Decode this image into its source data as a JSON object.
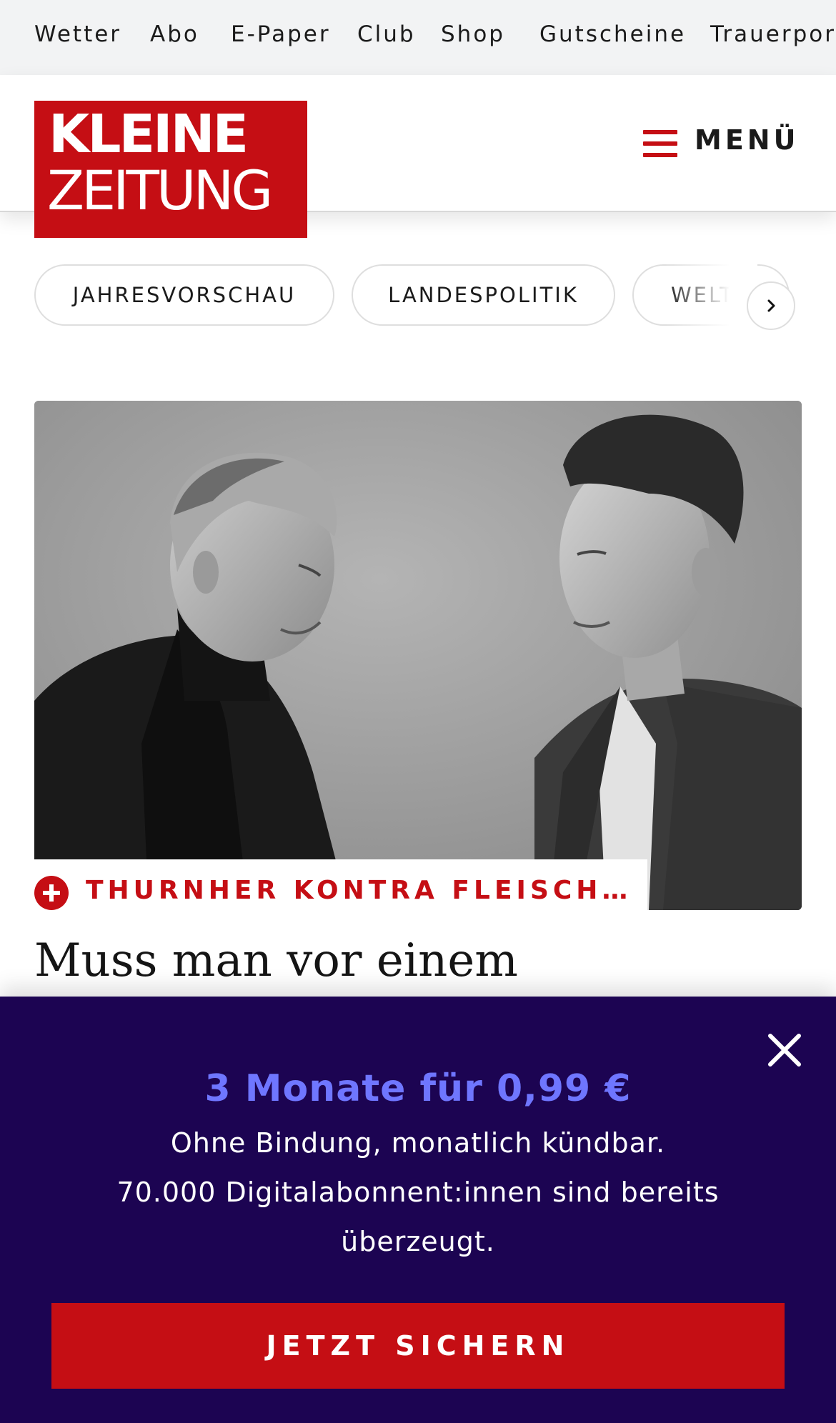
{
  "topnav": {
    "items": [
      "Wetter",
      "Abo",
      "E-Paper",
      "Club",
      "Shop",
      "Gutscheine",
      "Trauerportal"
    ]
  },
  "header": {
    "logo_line1": "KLEINE",
    "logo_line2": "ZEITUNG",
    "menu_label": "MENÜ"
  },
  "tags": [
    "JAHRESVORSCHAU",
    "LANDESPOLITIK",
    "WELT"
  ],
  "article": {
    "kicker": "THURNHER KONTRA FLEISCHHACKER",
    "headline": "Muss man vor einem"
  },
  "paywall": {
    "title": "3 Monate für 0,99 €",
    "line1": "Ohne Bindung, monatlich kündbar.",
    "line2": "70.000 Digitalabonnent:innen sind bereits",
    "line3": "überzeugt.",
    "cta": "JETZT SICHERN"
  },
  "colors": {
    "brand_red": "#c50e14",
    "paywall_bg": "#1c0452",
    "offer_accent": "#6f76ff"
  },
  "icons": [
    "hamburger-icon",
    "chevron-right-icon",
    "plus-icon",
    "close-icon"
  ]
}
